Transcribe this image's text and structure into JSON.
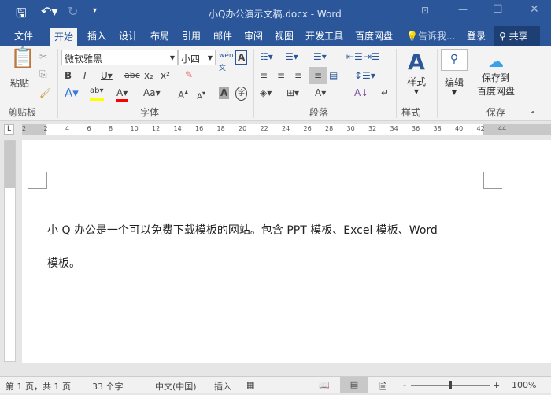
{
  "title": {
    "text": "小Q办公演示文稿.docx - Word"
  },
  "qat": {
    "save": "save-icon",
    "undo": "undo-icon",
    "redo": "redo-icon",
    "customize": "▾"
  },
  "tabs": [
    {
      "label": "文件"
    },
    {
      "label": "开始"
    },
    {
      "label": "插入"
    },
    {
      "label": "设计"
    },
    {
      "label": "布局"
    },
    {
      "label": "引用"
    },
    {
      "label": "邮件"
    },
    {
      "label": "审阅"
    },
    {
      "label": "视图"
    },
    {
      "label": "开发工具"
    },
    {
      "label": "百度网盘"
    }
  ],
  "tell_me": "告诉我...",
  "login": "登录",
  "share": "共享",
  "ribbon": {
    "paste": "粘贴",
    "clipboard": "剪贴板",
    "font_name": "微软雅黑",
    "font_size": "小四",
    "font_group": "字体",
    "para_group": "段落",
    "styles_btn": "样式",
    "styles_group": "样式",
    "edit_btn": "编辑",
    "save_baidu1": "保存到",
    "save_baidu2": "百度网盘",
    "save_group": "保存"
  },
  "ruler": [
    "2",
    "2",
    "4",
    "6",
    "8",
    "10",
    "12",
    "14",
    "16",
    "18",
    "20",
    "22",
    "24",
    "26",
    "28",
    "30",
    "32",
    "34",
    "36",
    "38",
    "40",
    "42",
    "44"
  ],
  "document": {
    "line1": "小 Q 办公是一个可以免费下载模板的网站。包含 PPT 模板、Excel 模板、Word",
    "line2": "模板。"
  },
  "status": {
    "page": "第 1 页，共 1 页",
    "words": "33 个字",
    "lang": "中文(中国)",
    "mode": "插入",
    "zoom": "100%",
    "zoom_level": 100
  },
  "colors": {
    "brand": "#2b579a",
    "highlight": "#ffff00",
    "font_color": "#ff0000"
  }
}
